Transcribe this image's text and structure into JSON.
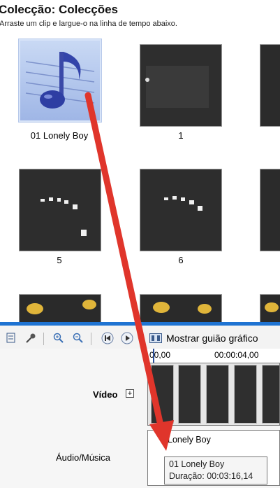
{
  "collection": {
    "title": "Colecção: Colecções",
    "subtitle": "Arraste um clip e largue-o na linha de tempo abaixo."
  },
  "clips": [
    {
      "label": "01 Lonely Boy",
      "kind": "audio",
      "selected": true
    },
    {
      "label": "1",
      "kind": "video"
    },
    {
      "label": "",
      "kind": "video"
    },
    {
      "label": "5",
      "kind": "video"
    },
    {
      "label": "6",
      "kind": "video"
    },
    {
      "label": "",
      "kind": "video"
    }
  ],
  "toolbar": {
    "storyboard_label": "Mostrar guião gráfico",
    "icons": [
      "storyboard-icon",
      "narrate-icon",
      "zoom-in-icon",
      "zoom-out-icon",
      "rewind-icon",
      "play-icon",
      "filmstrip-icon"
    ]
  },
  "timeline": {
    "ruler_start": "00,00",
    "ruler_next": "00:00:04,00",
    "video_label": "Vídeo",
    "audio_label": "Áudio/Música",
    "audio_clip_name": "Lonely Boy"
  },
  "tooltip": {
    "line1": "01 Lonely Boy",
    "line2": "Duração: 00:03:16,14"
  },
  "colors": {
    "accent": "#1e73d2",
    "arrow": "#e0352b"
  }
}
